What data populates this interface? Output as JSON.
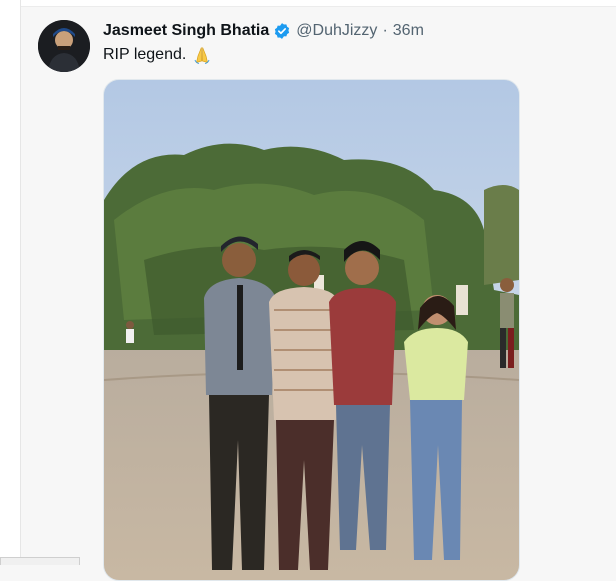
{
  "tweet": {
    "author_name": "Jasmeet Singh Bhatia",
    "handle": "@DuhJizzy",
    "separator": "·",
    "time_ago": "36m",
    "text": "RIP legend.",
    "emoji": "folded-hands",
    "verified_color": "#1d9bf0"
  },
  "status_bar": {
    "text": ""
  },
  "icons": {
    "verified": "verified-badge-icon",
    "emoji": "folded-hands-emoji-icon"
  }
}
